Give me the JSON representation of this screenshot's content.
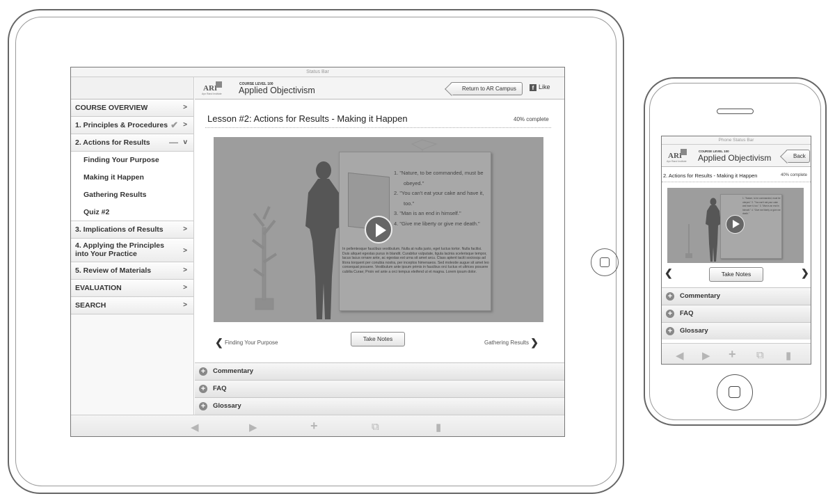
{
  "tablet": {
    "status_bar": "Status Bar",
    "logo": {
      "text": "ARI",
      "subtext": "Ayn Rand Institute"
    },
    "course_level": "COURSE LEVEL 100",
    "course_title": "Applied Objectivism",
    "return_button": "Return to AR Campus",
    "like_label": "Like",
    "sidebar": {
      "items": [
        {
          "label": "COURSE OVERVIEW"
        },
        {
          "label": "1. Principles & Procedures"
        },
        {
          "label": "2. Actions for Results"
        },
        {
          "label": "Finding Your Purpose"
        },
        {
          "label": "Making it Happen"
        },
        {
          "label": "Gathering Results"
        },
        {
          "label": "Quiz #2"
        },
        {
          "label": "3. Implications of Results"
        },
        {
          "label": "4. Applying the Principles into Your Practice"
        },
        {
          "label": "5. Review of Materials"
        },
        {
          "label": "EVALUATION"
        },
        {
          "label": "SEARCH"
        }
      ]
    },
    "lesson_title": "Lesson #2:  Actions for Results - Making it Happen",
    "progress": "40% complete",
    "progress_value": 40,
    "video": {
      "quotes": [
        "1. \"Nature, to be commanded, must be obeyed.\"",
        "2. \"You can't eat your cake and have it, too.\"",
        "3. \"Man is an end in himself.\"",
        "4. \"Give me liberty or give me death.\""
      ],
      "lorem": "In pellentesque faucibus vestibulum. Nulla at nulla justo, eget luctus tortor. Nulla facilisi. Duis aliquet egestas purus in blandit. Curabitur vulputate, ligula lacinia scelerisque tempor, lacus lacus ornare ante, ac egestas est urna sit amet arcu. Class aptent taciti sociosqu ad litora torquent per conubia nostra, per inceptos himenaeos. Sed molestie augue sit amet leo consequat posuere. Vestibulum ante ipsum primis in faucibus orci luctus et ultrices posuere cubilia Curae; Proin vel ante a orci tempus eleifend ut et magna. Lorem ipsum dolor."
    },
    "prev_label": "Finding Your Purpose",
    "next_label": "Gathering Results",
    "take_notes": "Take Notes",
    "accordion": [
      "Commentary",
      "FAQ",
      "Glossary"
    ],
    "toolbar_icons": [
      "back-arrow-icon",
      "forward-arrow-icon",
      "plus-icon",
      "share-icon",
      "copy-icon"
    ]
  },
  "phone": {
    "status_bar": "Phone Status Bar",
    "logo": {
      "text": "ARI",
      "subtext": "Ayn Rand Institute"
    },
    "course_level": "COURSE LEVEL 100",
    "course_title": "Applied Objectivism",
    "back_button": "Back",
    "lesson_title": "2. Actions for Results - Making it Happen",
    "progress": "40% complete",
    "progress_value": 40,
    "video_mini_text": "1. \"Nature, to be commanded, must be obeyed.\" 2. \"You can't eat your cake and have it, too.\" 3. \"Man is an end in himself.\" 4. \"Give me liberty or give me death.\"",
    "take_notes": "Take Notes",
    "accordion": [
      "Commentary",
      "FAQ",
      "Glossary"
    ],
    "toolbar_icons": [
      "back-arrow-icon",
      "forward-arrow-icon",
      "plus-icon",
      "share-icon",
      "copy-icon"
    ]
  }
}
